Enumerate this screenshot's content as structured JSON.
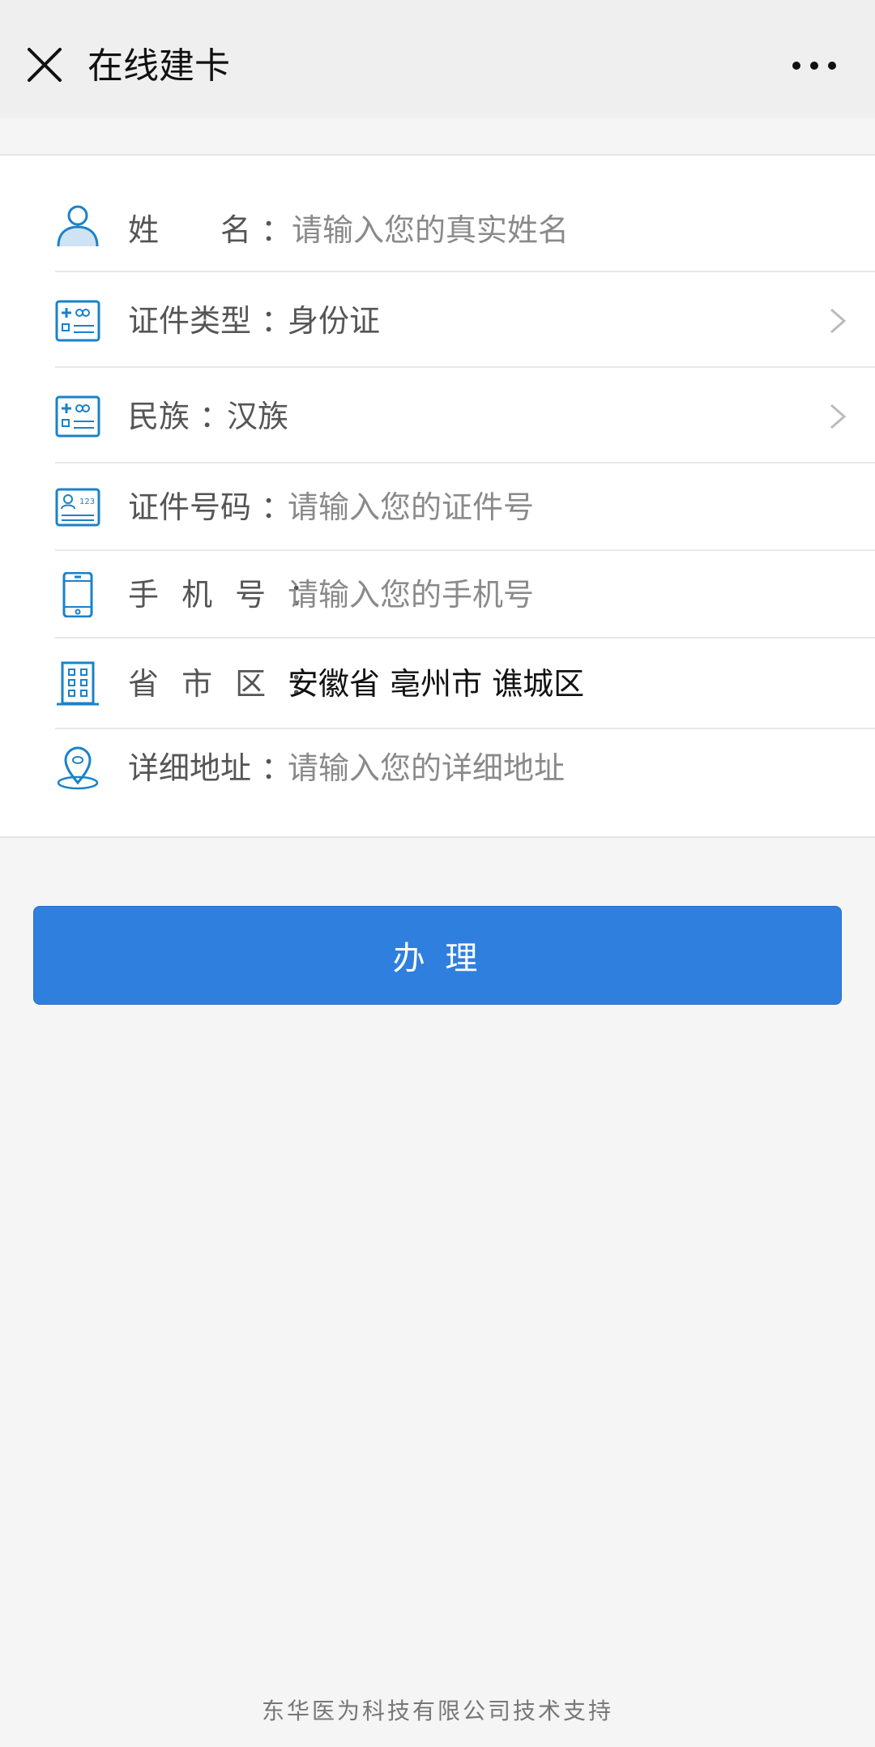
{
  "header": {
    "title": "在线建卡",
    "close_icon": "close-icon",
    "more_icon": "more-dots-icon"
  },
  "form": {
    "rows": [
      {
        "label": "姓　　名 ：",
        "value": "请输入您的真实姓名",
        "icon": "person-icon",
        "placeholder": true
      },
      {
        "label": "证件类型 ：",
        "value": "身份证",
        "icon": "id-card-icon",
        "placeholder": false
      },
      {
        "label": "民族 ：",
        "value": "汉族",
        "icon": "id-card-icon",
        "placeholder": false
      },
      {
        "label": "证件号码 ：",
        "value": "请输入您的证件号",
        "icon": "id-number-icon",
        "placeholder": true
      },
      {
        "label": "手 机 号 ：",
        "value": "请输入您的手机号",
        "icon": "phone-icon",
        "placeholder": true
      },
      {
        "label": "省 市 区 ：",
        "value": "安徽省 亳州市 谯城区",
        "icon": "building-icon",
        "placeholder": false
      },
      {
        "label": "详细地址 ：",
        "value": "请输入您的详细地址",
        "icon": "location-pin-icon",
        "placeholder": true
      }
    ]
  },
  "submit_label": "办 理",
  "footer": "东华医为科技有限公司技术支持",
  "colors": {
    "accent": "#2f7fde",
    "icon": "#1a82c8",
    "background": "#f5f5f6"
  }
}
